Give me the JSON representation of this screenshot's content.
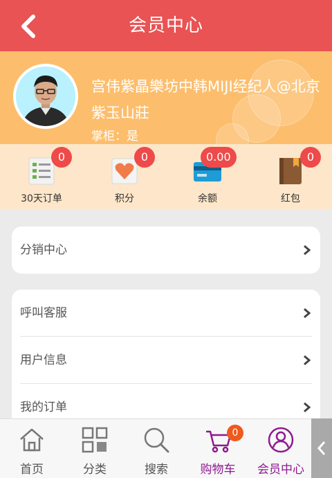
{
  "header": {
    "title": "会员中心",
    "back_icon": "chevron-left-icon"
  },
  "profile": {
    "nickname": "宫伟紫晶樂坊中韩MIJI经纪人@北京紫玉山莊",
    "role": "掌柜：是"
  },
  "stats": [
    {
      "label": "30天订单",
      "count": "0",
      "icon": "order-list-icon"
    },
    {
      "label": "积分",
      "count": "0",
      "icon": "heart-icon"
    },
    {
      "label": "余额",
      "count": "0.00",
      "icon": "card-icon"
    },
    {
      "label": "红包",
      "count": "0",
      "icon": "red-packet-icon"
    }
  ],
  "menu": {
    "distribution": "分销中心",
    "service": "呼叫客服",
    "user_info": "用户信息",
    "my_orders": "我的订单"
  },
  "tabbar": [
    {
      "label": "首页",
      "icon": "home-icon"
    },
    {
      "label": "分类",
      "icon": "category-grid-icon"
    },
    {
      "label": "搜索",
      "icon": "search-icon"
    },
    {
      "label": "购物车",
      "icon": "cart-icon",
      "badge": "0"
    },
    {
      "label": "会员中心",
      "icon": "user-icon"
    }
  ],
  "colors": {
    "header": "#e95353",
    "profile_bg": "#fcbe6d",
    "stats_bg": "#fde6c9",
    "badge": "#ee4a4a",
    "active_tab": "#8e1a8e"
  }
}
